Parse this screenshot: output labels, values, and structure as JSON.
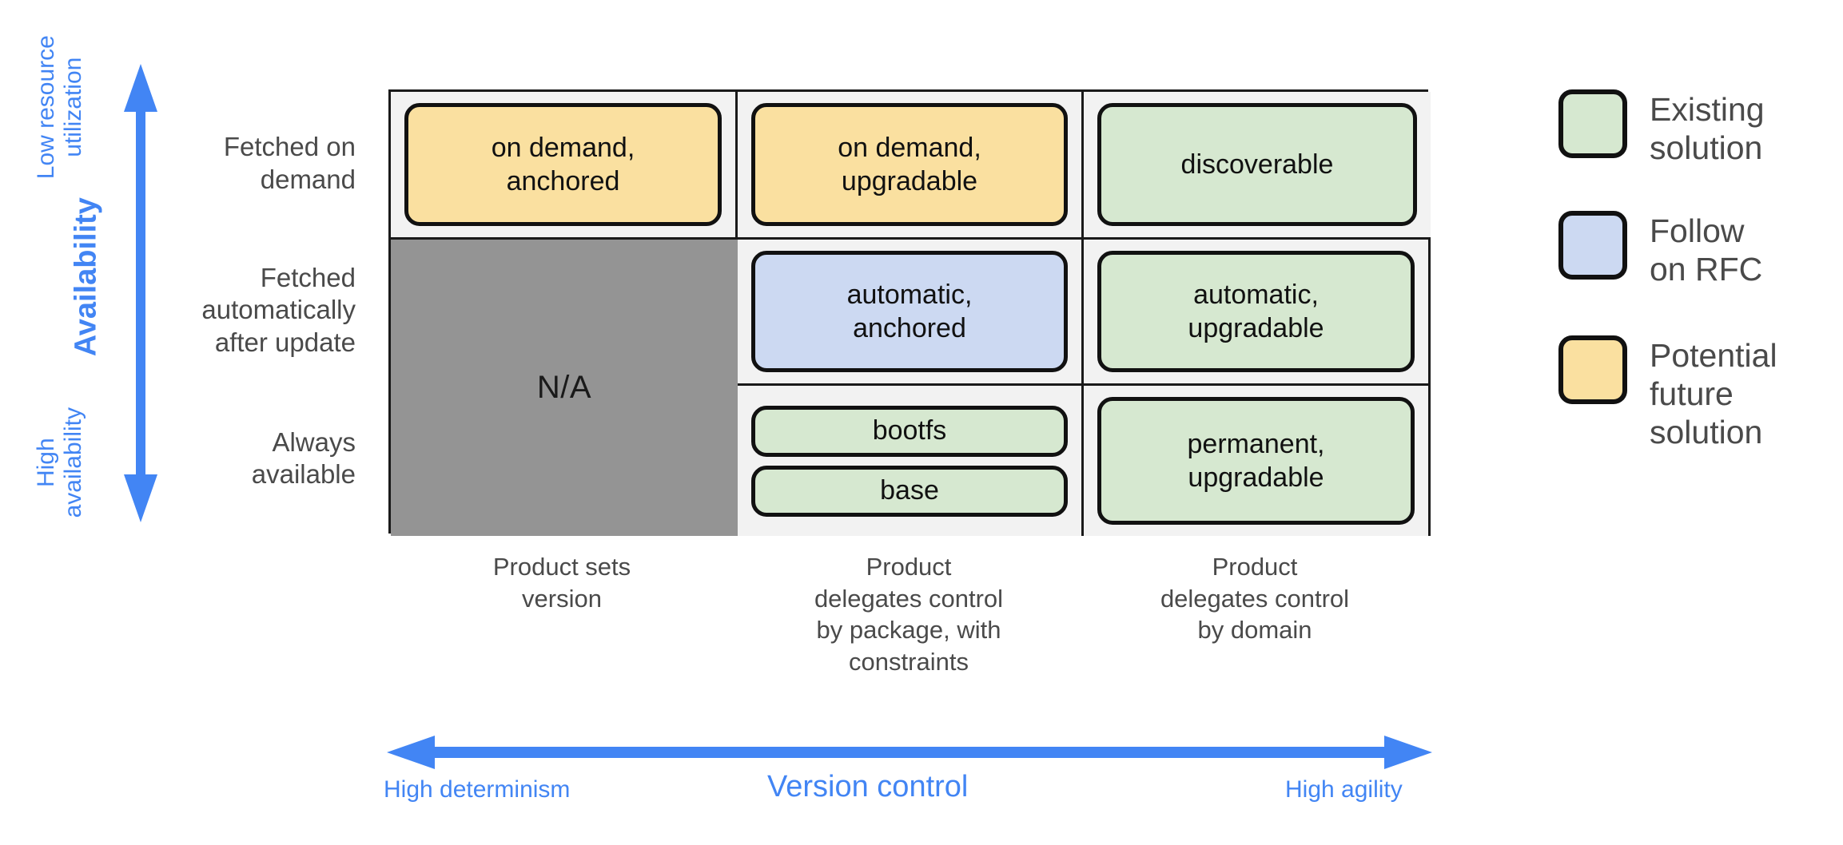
{
  "colors": {
    "existing": "#d6e8d0",
    "rfc": "#ccd9f2",
    "future": "#fae0a0",
    "na": "#949494",
    "accent": "#4285f4",
    "text": "#4a4a4a",
    "outline": "#111111",
    "cell_bg": "#f2f2f2"
  },
  "y_axis": {
    "top_label": "Low resource\nutilization",
    "main_label": "Availability",
    "bottom_label": "High\navailability",
    "icon": "double-headed-vertical-arrow-icon"
  },
  "x_axis": {
    "left_label": "High determinism",
    "main_label": "Version control",
    "right_label": "High agility",
    "icon": "double-headed-horizontal-arrow-icon"
  },
  "rows": [
    {
      "label": "Fetched on\ndemand"
    },
    {
      "label": "Fetched\nautomatically\nafter update"
    },
    {
      "label": "Always\navailable"
    }
  ],
  "columns": [
    {
      "label": "Product sets\nversion"
    },
    {
      "label": "Product\ndelegates control\nby package, with\nconstraints"
    },
    {
      "label": "Product\ndelegates control\nby domain"
    }
  ],
  "matrix": [
    [
      {
        "kind": "boxes",
        "boxes": [
          {
            "label": "on demand,\nanchored",
            "color": "future"
          }
        ]
      },
      {
        "kind": "boxes",
        "boxes": [
          {
            "label": "on demand,\nupgradable",
            "color": "future"
          }
        ]
      },
      {
        "kind": "boxes",
        "boxes": [
          {
            "label": "discoverable",
            "color": "existing"
          }
        ]
      }
    ],
    [
      {
        "kind": "boxes",
        "boxes": [
          {
            "label": "automatic,\nanchored",
            "color": "rfc"
          }
        ]
      },
      {
        "kind": "boxes",
        "boxes": [
          {
            "label": "automatic,\nupgradable",
            "color": "existing"
          }
        ]
      },
      {
        "kind": "na",
        "label": "N/A"
      }
    ],
    [
      {
        "kind": "boxes",
        "boxes": [
          {
            "label": "bootfs",
            "color": "existing",
            "short": true
          },
          {
            "label": "base",
            "color": "existing",
            "short": true
          }
        ]
      },
      {
        "kind": "boxes",
        "boxes": [
          {
            "label": "permanent,\nupgradable",
            "color": "existing"
          }
        ]
      },
      {
        "kind": "na-cont",
        "label": ""
      }
    ]
  ],
  "legend": {
    "items": [
      {
        "label": "Existing\nsolution",
        "color": "existing"
      },
      {
        "label": "Follow\non RFC",
        "color": "rfc"
      },
      {
        "label": "Potential\nfuture\nsolution",
        "color": "future"
      }
    ]
  }
}
